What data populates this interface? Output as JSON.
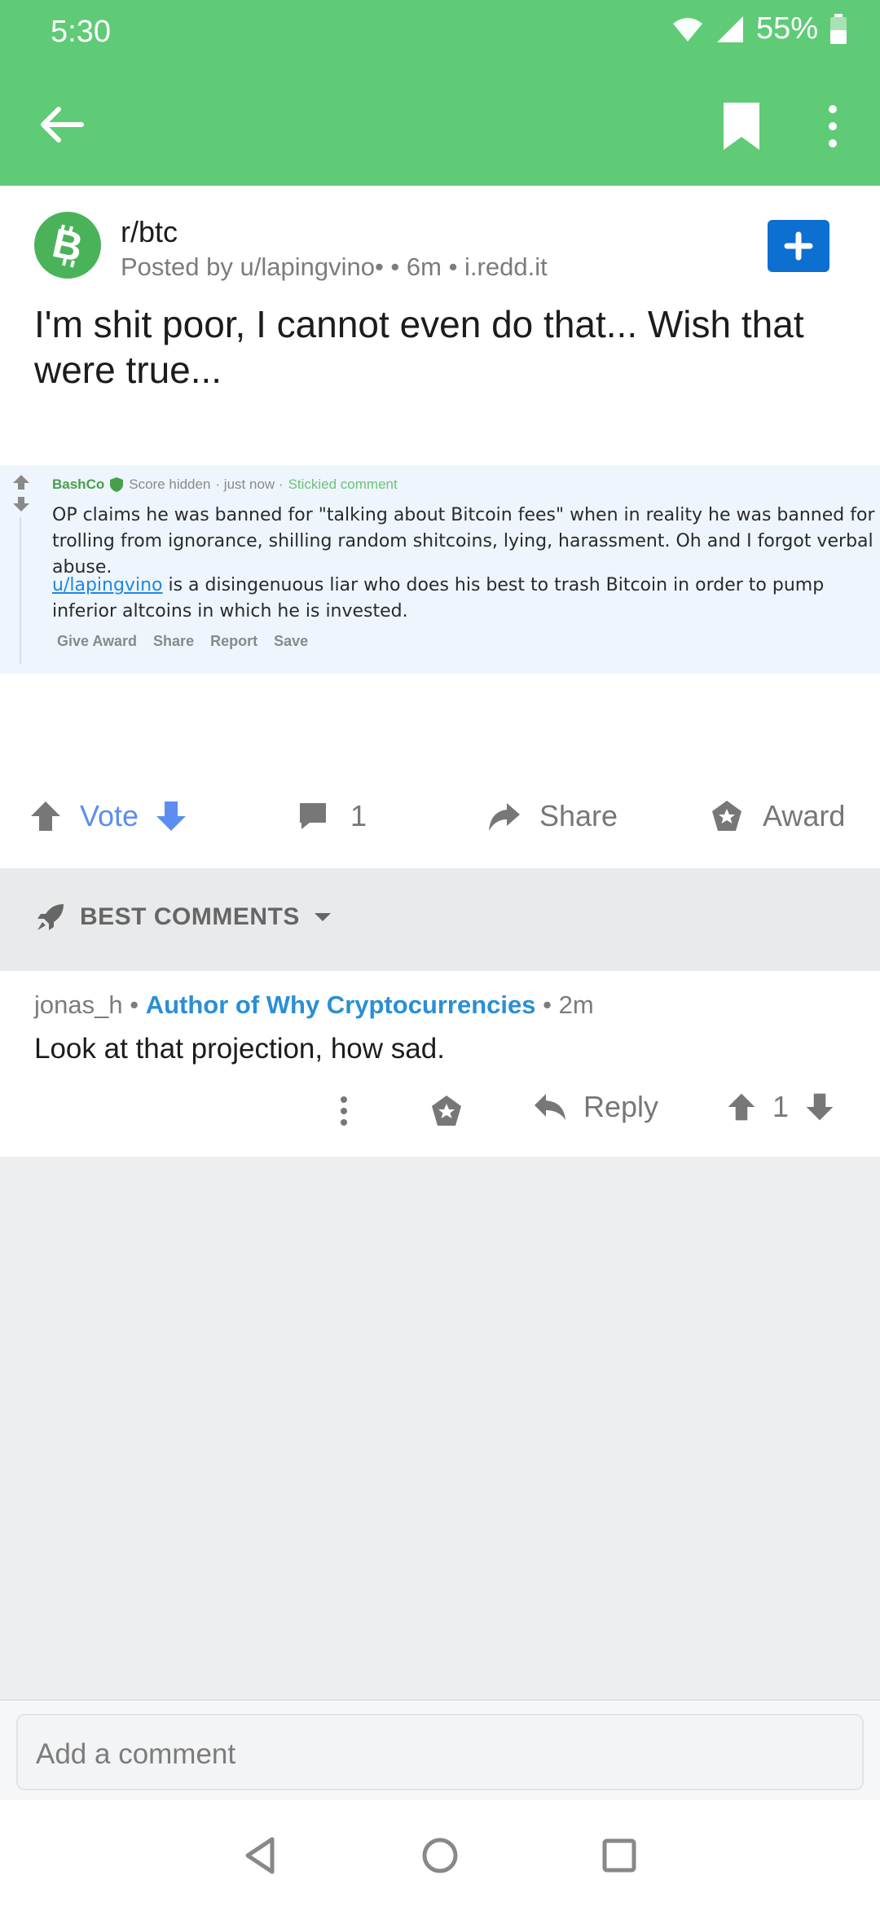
{
  "status_bar": {
    "time": "5:30",
    "battery": "55%"
  },
  "post": {
    "subreddit": "r/btc",
    "posted_by": "Posted by u/lapingvino•",
    "age": "• 6m •",
    "domain": "i.redd.it",
    "title": "I'm shit poor, I cannot even do that... Wish that were true..."
  },
  "embedded_image": {
    "author": "BashCo",
    "score": "Score hidden",
    "time": "· just now ·",
    "stickied": "Stickied comment",
    "paragraph1": "OP claims he was banned for \"talking about Bitcoin fees\" when in reality he was banned for trolling from ignorance, shilling random shitcoins, lying, harassment. Oh and I forgot verbal abuse.",
    "user_link": "u/lapingvino",
    "paragraph2_rest": " is a disingenuous liar who does his best to trash Bitcoin in order to pump inferior altcoins in which he is invested.",
    "actions": [
      "Give Award",
      "Share",
      "Report",
      "Save"
    ]
  },
  "actions": {
    "vote": "Vote",
    "comments": "1",
    "share": "Share",
    "award": "Award"
  },
  "sort": {
    "label": "BEST COMMENTS"
  },
  "comment": {
    "author": "jonas_h",
    "flair": "Author of Why Cryptocurrencies",
    "age": "• 2m",
    "body": "Look at that projection, how sad.",
    "reply": "Reply",
    "score": "1"
  },
  "comment_input": {
    "placeholder": "Add a comment"
  },
  "colors": {
    "header": "#5fcb77",
    "vote": "#5b8ef0",
    "flair": "#2a8fd4",
    "join": "#0d6fcf"
  }
}
